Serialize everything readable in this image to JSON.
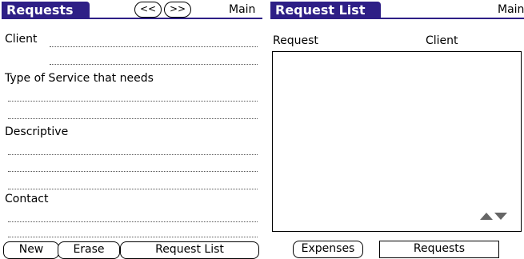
{
  "left_panel": {
    "title": "Requests",
    "nav_prev": "<<",
    "nav_next": ">>",
    "menu": "Main",
    "fields": {
      "client": "Client",
      "service": "Type of Service that needs",
      "descriptive": "Descriptive",
      "contact": "Contact"
    },
    "buttons": {
      "new": "New",
      "erase": "Erase",
      "request_list": "Request List"
    }
  },
  "right_panel": {
    "title": "Request List",
    "menu": "Main",
    "columns": [
      "Request",
      "Client"
    ],
    "buttons": {
      "expenses": "Expenses",
      "requests": "Requests"
    }
  },
  "colors": {
    "title_bar": "#2e1f86"
  }
}
